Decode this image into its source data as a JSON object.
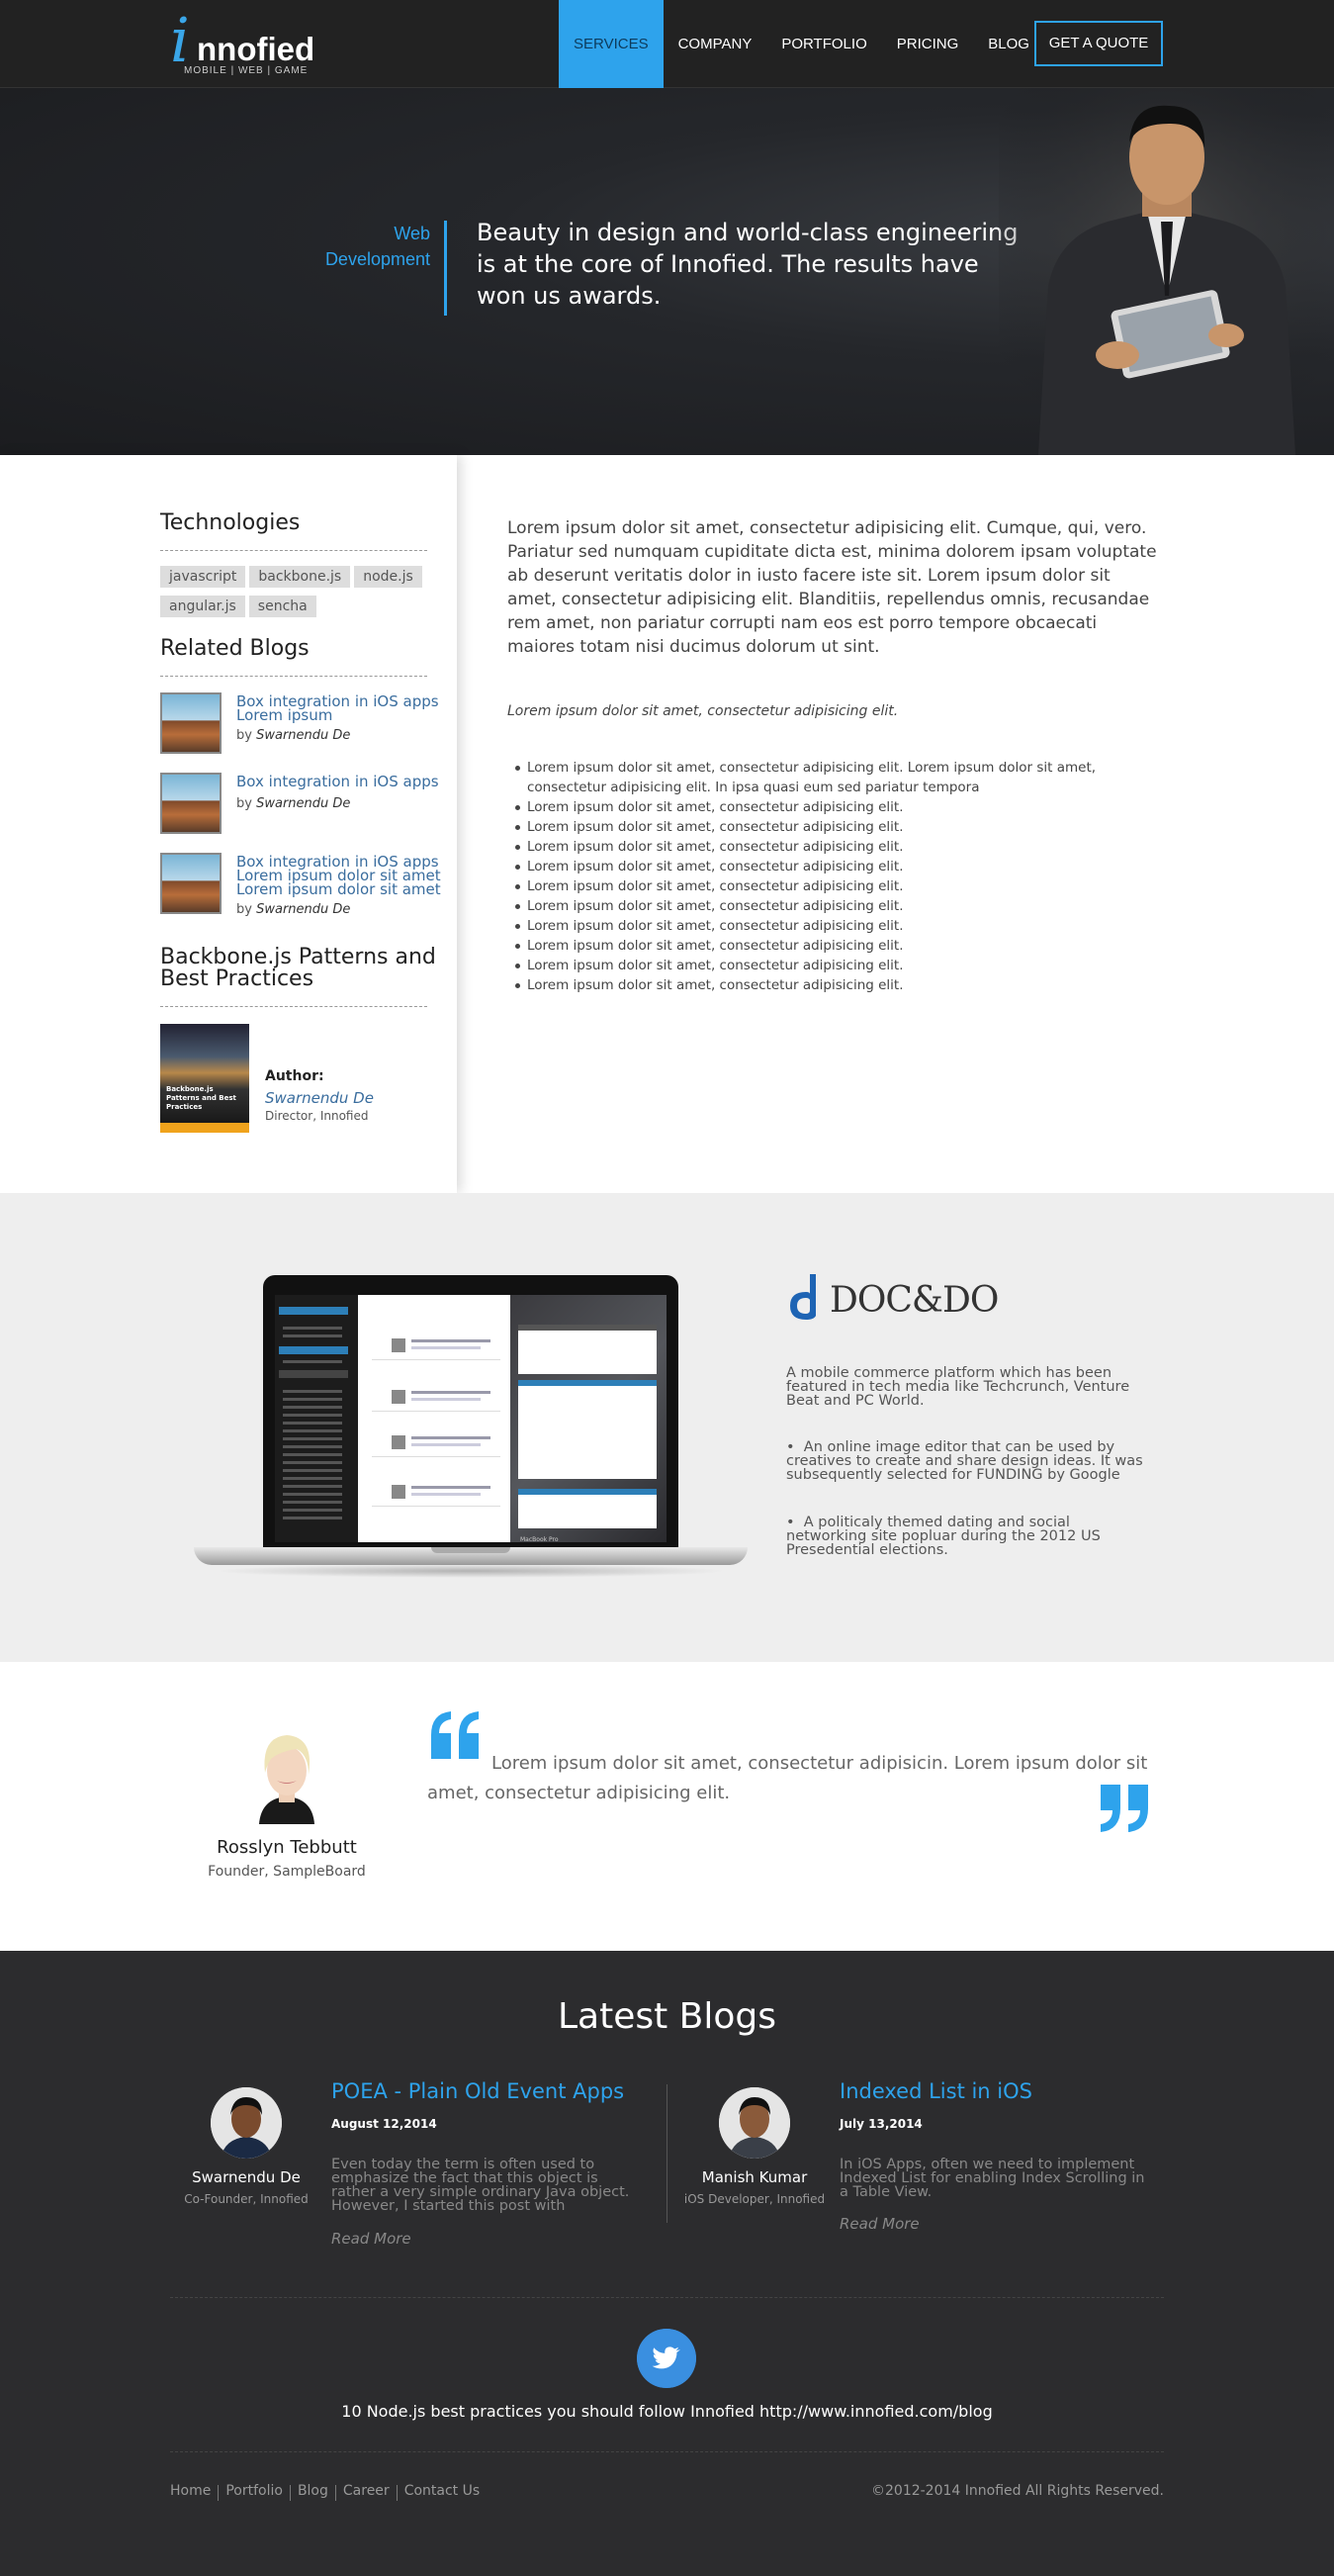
{
  "brand": {
    "letter": "i",
    "name": "nnofied",
    "tagline": "MOBILE | WEB | GAME"
  },
  "nav": {
    "items": [
      "SERVICES",
      "COMPANY",
      "PORTFOLIO",
      "PRICING",
      "BLOG"
    ],
    "active": "SERVICES",
    "cta": "GET A QUOTE"
  },
  "hero": {
    "label": "Web Development",
    "text": "Beauty in design and world-class engineering is at the core of Innofied. The results have won us awards."
  },
  "sidebar": {
    "technologies_title": "Technologies",
    "tags": [
      "javascript",
      "backbone.js",
      "node.js",
      "angular.js",
      "sencha"
    ],
    "related_title": "Related Blogs",
    "related": [
      {
        "title": "Box integration in iOS apps Lorem ipsum",
        "by": "by",
        "author": "Swarnendu De"
      },
      {
        "title": "Box integration in iOS apps",
        "by": "by",
        "author": "Swarnendu De"
      },
      {
        "title": "Box integration in iOS apps Lorem ipsum dolor sit amet Lorem ipsum dolor sit amet",
        "by": "by",
        "author": "Swarnendu De"
      }
    ],
    "book_section_title": "Backbone.js Patterns and Best Practices",
    "book_cover_title": "Backbone.js Patterns and Best Practices",
    "author_label": "Author:",
    "author_name": "Swarnendu De",
    "author_role": "Director, Innofied"
  },
  "main": {
    "intro": "Lorem ipsum dolor sit amet, consectetur adipisicing elit. Cumque, qui, vero. Pariatur sed numquam cupiditate dicta est, minima dolorem ipsam voluptate ab deserunt veritatis dolor in iusto facere iste sit. Lorem ipsum dolor sit amet, consectetur adipisicing elit. Blanditiis, repellendus omnis, recusandae rem amet, non pariatur corrupti nam eos est porro tempore obcaecati maiores totam nisi ducimus dolorum ut sint.",
    "italic": "Lorem ipsum dolor sit amet, consectetur adipisicing elit.",
    "list": [
      "Lorem ipsum dolor sit amet, consectetur adipisicing elit. Lorem ipsum dolor sit amet, consectetur adipisicing elit. In ipsa quasi eum sed pariatur tempora",
      "Lorem ipsum dolor sit amet, consectetur adipisicing elit.",
      "Lorem ipsum dolor sit amet, consectetur adipisicing elit.",
      "Lorem ipsum dolor sit amet, consectetur adipisicing elit.",
      "Lorem ipsum dolor sit amet, consectetur adipisicing elit.",
      "Lorem ipsum dolor sit amet, consectetur adipisicing elit.",
      "Lorem ipsum dolor sit amet, consectetur adipisicing elit.",
      "Lorem ipsum dolor sit amet, consectetur adipisicing elit.",
      "Lorem ipsum dolor sit amet, consectetur adipisicing elit.",
      "Lorem ipsum dolor sit amet, consectetur adipisicing elit.",
      "Lorem ipsum dolor sit amet, consectetur adipisicing elit."
    ]
  },
  "portfolio": {
    "logo_text": "DOC&DO",
    "laptop_label": "MacBook Pro",
    "paragraph": "A mobile commerce platform which has been featured in tech media like Techcrunch, Venture Beat and PC World.",
    "bullets": [
      "An online image editor that can be used by creatives to create and share design ideas. It was subsequently selected for FUNDING by Google",
      "A politicaly themed dating and social networking site popluar during the 2012 US Presedential elections."
    ]
  },
  "testimonial": {
    "name": "Rosslyn Tebbutt",
    "role": "Founder, SampleBoard",
    "quote": "Lorem ipsum dolor sit amet, consectetur adipisicin. Lorem ipsum dolor sit amet, consectetur adipisicing elit."
  },
  "blogs": {
    "title": "Latest Blogs",
    "posts": [
      {
        "author": "Swarnendu De",
        "role": "Co-Founder, Innofied",
        "title": "POEA - Plain Old Event Apps",
        "date": "August 12,2014",
        "excerpt": "Even today the term is often used to emphasize the fact that this object is rather a very simple ordinary Java object. However, I started this post with",
        "more": "Read More"
      },
      {
        "author": "Manish Kumar",
        "role": "iOS Developer, Innofied",
        "title": "Indexed List in iOS",
        "date": "July 13,2014",
        "excerpt": "In iOS Apps, often we need to implement Indexed List for enabling Index Scrolling in a Table View.",
        "more": "Read More"
      }
    ],
    "tweet": "10 Node.js best practices you should follow Innofied http://www.innofied.com/blog"
  },
  "footer": {
    "links": [
      "Home",
      "Portfolio",
      "Blog",
      "Career",
      "Contact Us"
    ],
    "copyright": "©2012-2014 Innofied All Rights Reserved."
  },
  "colors": {
    "accent": "#2ea3ec",
    "dark": "#222222",
    "link": "#3a6d9e"
  },
  "icons": [
    "twitter-icon",
    "quote-open-icon",
    "quote-close-icon"
  ]
}
